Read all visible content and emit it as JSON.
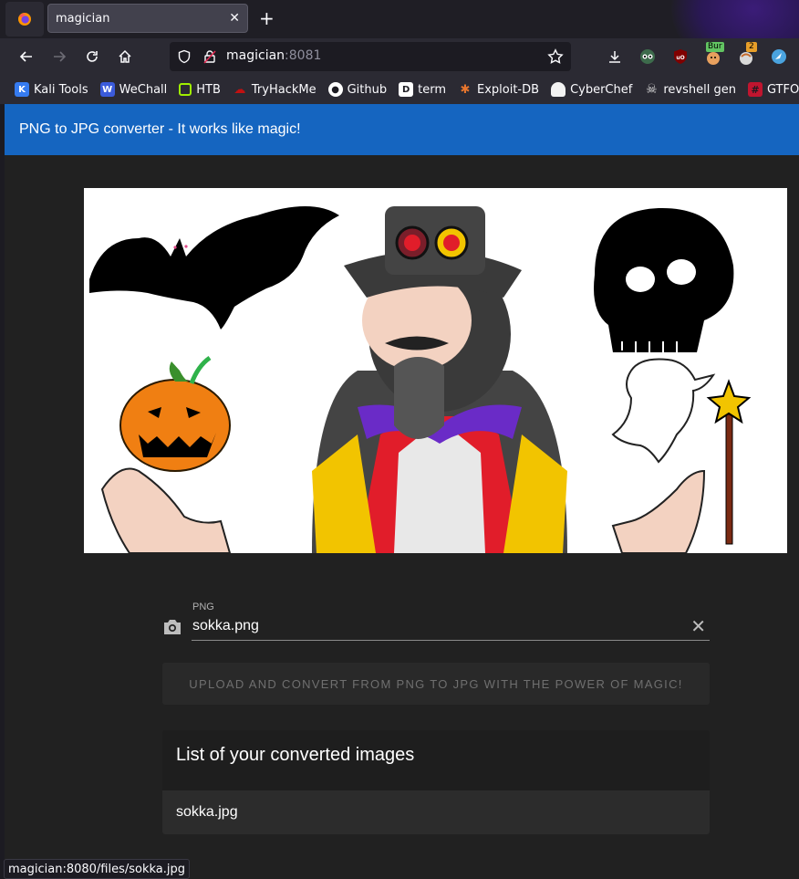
{
  "browser": {
    "tab_title": "magician",
    "url_host": "magician",
    "url_port": ":8081",
    "status_url": "magician:8080/files/sokka.jpg"
  },
  "bookmarks": [
    {
      "label": "Kali Tools",
      "icon": "kali-icon",
      "color": "#367bf0"
    },
    {
      "label": "WeChall",
      "icon": "wechall-icon",
      "color": "#3b5bdb"
    },
    {
      "label": "HTB",
      "icon": "htb-icon",
      "color": "#9fef00"
    },
    {
      "label": "TryHackMe",
      "icon": "tryhackme-icon",
      "color": "#c11111"
    },
    {
      "label": "Github",
      "icon": "github-icon",
      "color": "#ffffff"
    },
    {
      "label": "term",
      "icon": "term-icon",
      "color": "#ffffff"
    },
    {
      "label": "Exploit-DB",
      "icon": "exploitdb-icon",
      "color": "#e8762d"
    },
    {
      "label": "CyberChef",
      "icon": "cyberchef-icon",
      "color": "#f2f2f2"
    },
    {
      "label": "revshell gen",
      "icon": "skull-icon",
      "color": "#dddddd"
    },
    {
      "label": "GTFOBins",
      "icon": "gtfobins-icon",
      "color": "#c0152f"
    }
  ],
  "app": {
    "title": "PNG to JPG converter - It works like magic!",
    "file_label": "PNG",
    "file_value": "sokka.png",
    "convert_label": "UPLOAD AND CONVERT FROM PNG TO JPG WITH THE POWER OF MAGIC!",
    "list_title": "List of your converted images",
    "items": [
      "sokka.jpg"
    ]
  },
  "extensions": {
    "burp_badge": "Bur",
    "notif_badge": "2"
  },
  "colors": {
    "appbar": "#1565c0",
    "page_bg": "#212121",
    "chrome_bg": "#2b2a33"
  }
}
